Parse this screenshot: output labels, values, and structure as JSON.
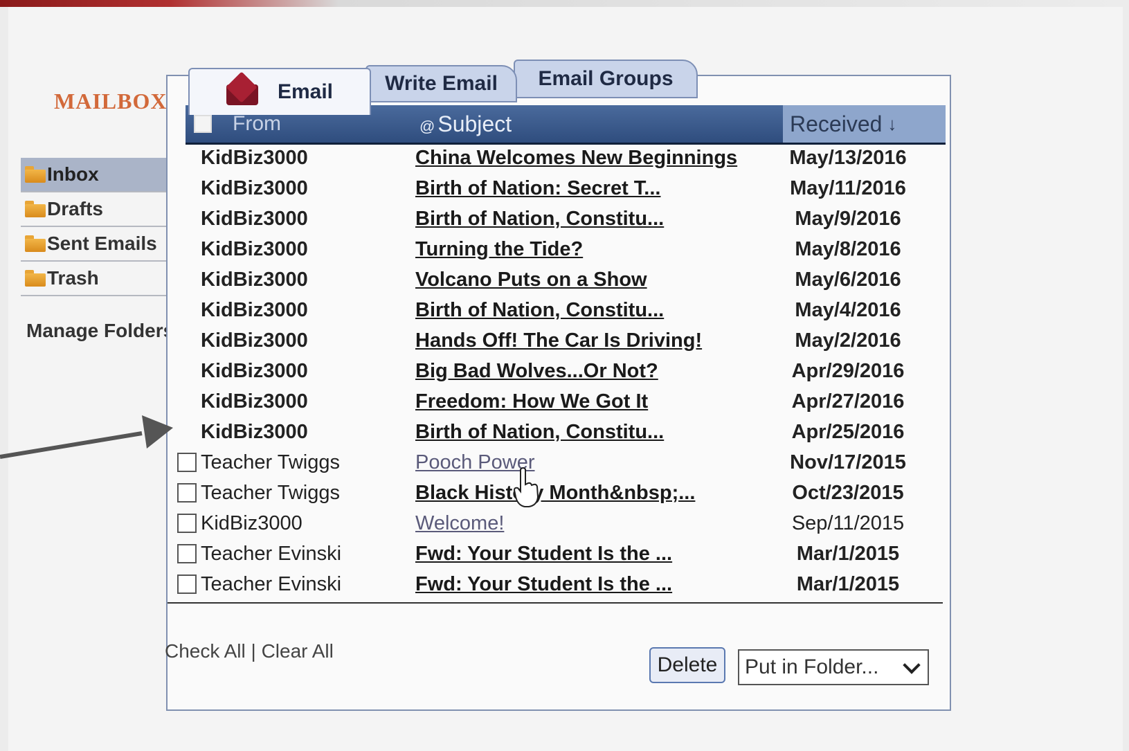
{
  "app": {
    "title": "MAILBOX"
  },
  "sidebar": {
    "items": [
      {
        "label": "Inbox",
        "active": true
      },
      {
        "label": "Drafts",
        "active": false
      },
      {
        "label": "Sent Emails",
        "active": false
      },
      {
        "label": "Trash",
        "active": false
      }
    ],
    "manage_label": "Manage Folders"
  },
  "tabs": [
    {
      "label": "Email",
      "icon": "envelope-icon"
    },
    {
      "label": "Write Email"
    },
    {
      "label": "Email Groups"
    }
  ],
  "table": {
    "headers": {
      "from": "From",
      "subject": "Subject",
      "received": "Received"
    },
    "rows": [
      {
        "from": "KidBiz3000",
        "subject": "China Welcomes New Beginnings",
        "received": "May/13/2016"
      },
      {
        "from": "KidBiz3000",
        "subject": "Birth of Nation: Secret T...",
        "received": "May/11/2016"
      },
      {
        "from": "KidBiz3000",
        "subject": "Birth of Nation, Constitu...",
        "received": "May/9/2016"
      },
      {
        "from": "KidBiz3000",
        "subject": "Turning the Tide?",
        "received": "May/8/2016"
      },
      {
        "from": "KidBiz3000",
        "subject": "Volcano Puts on a Show",
        "received": "May/6/2016"
      },
      {
        "from": "KidBiz3000",
        "subject": "Birth of Nation, Constitu...",
        "received": "May/4/2016"
      },
      {
        "from": "KidBiz3000",
        "subject": "Hands Off! The Car Is Driving!",
        "received": "May/2/2016"
      },
      {
        "from": "KidBiz3000",
        "subject": "Big Bad Wolves...Or Not?",
        "received": "Apr/29/2016"
      },
      {
        "from": "KidBiz3000",
        "subject": "Freedom: How We Got It",
        "received": "Apr/27/2016"
      },
      {
        "from": "KidBiz3000",
        "subject": "Birth of Nation, Constitu...",
        "received": "Apr/25/2016"
      },
      {
        "from": "Teacher Twiggs",
        "subject": "Pooch Power",
        "received": "Nov/17/2015"
      },
      {
        "from": "Teacher Twiggs",
        "subject": "Black History Month&nbsp;...",
        "received": "Oct/23/2015"
      },
      {
        "from": "KidBiz3000",
        "subject": "Welcome!",
        "received": "Sep/11/2015"
      },
      {
        "from": "Teacher Evinski",
        "subject": "Fwd: Your Student Is the ...",
        "received": "Mar/1/2015"
      },
      {
        "from": "Teacher Evinski",
        "subject": "Fwd: Your Student Is the ...",
        "received": "Mar/1/2015"
      }
    ]
  },
  "footer": {
    "check_all": "Check All",
    "separator": " | ",
    "clear_all": "Clear All",
    "delete_label": "Delete",
    "folder_select_value": "Put in Folder..."
  },
  "colors": {
    "header": "#2f4d7e",
    "accent": "#d2693a",
    "active_folder": "#aab4c8"
  }
}
